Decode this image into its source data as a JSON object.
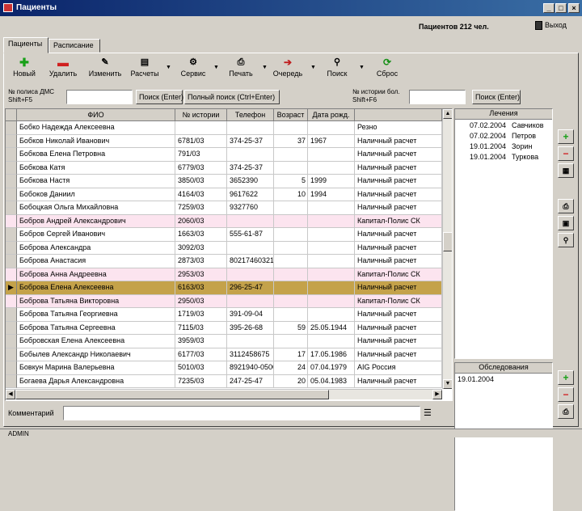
{
  "window": {
    "title": "Пациенты"
  },
  "header": {
    "count_label": "Пациентов 212 чел.",
    "exit_label": "Выход"
  },
  "tabs": [
    {
      "label": "Пациенты"
    },
    {
      "label": "Расписание"
    }
  ],
  "toolbar": {
    "new_label": "Новый",
    "delete_label": "Удалить",
    "edit_label": "Изменить",
    "bills_label": "Расчеты",
    "service_label": "Сервис",
    "print_label": "Печать",
    "queue_label": "Очередь",
    "search_label": "Поиск",
    "reset_label": "Сброс"
  },
  "search": {
    "policy_label_1": "№ полиса ДМС",
    "policy_label_2": "Shift+F5",
    "find_button": "Поиск (Enter)",
    "full_search_button": "Полный поиск (Ctrl+Enter)",
    "history_label_1": "№ истории бол.",
    "history_label_2": "Shift+F6",
    "find_button_2": "Поиск (Enter)"
  },
  "grid": {
    "columns": [
      "ФИО",
      "№ истории",
      "Телефон",
      "Возраст",
      "Дата рожд.",
      ""
    ],
    "rows": [
      {
        "name": "Бобко Надежда Алексеевна",
        "hist": "",
        "phone": "",
        "age": "",
        "dob": "",
        "pay": "Резно",
        "type": ""
      },
      {
        "name": "Бобков Николай Иванович",
        "hist": "6781/03",
        "phone": "374-25-37",
        "age": "37",
        "dob": "1967",
        "pay": "Наличный расчет",
        "type": ""
      },
      {
        "name": "Бобкова Елена Петровна",
        "hist": "791/03",
        "phone": "",
        "age": "",
        "dob": "",
        "pay": "Наличный расчет",
        "type": ""
      },
      {
        "name": "Бобкова Катя",
        "hist": "6779/03",
        "phone": "374-25-37",
        "age": "",
        "dob": "",
        "pay": "Наличный расчет",
        "type": ""
      },
      {
        "name": "Бобкова Настя",
        "hist": "3850/03",
        "phone": "3652390",
        "age": "5",
        "dob": "1999",
        "pay": "Наличный расчет",
        "type": ""
      },
      {
        "name": "Бобоков Даниил",
        "hist": "4164/03",
        "phone": "9617622",
        "age": "10",
        "dob": "1994",
        "pay": "Наличный расчет",
        "type": ""
      },
      {
        "name": "Бобоцкая Ольга Михайловна",
        "hist": "7259/03",
        "phone": "9327760",
        "age": "",
        "dob": "",
        "pay": "Наличный расчет",
        "type": ""
      },
      {
        "name": "Бобров Андрей Александрович",
        "hist": "2060/03",
        "phone": "",
        "age": "",
        "dob": "",
        "pay": "Капитал-Полис СК",
        "type": "pink"
      },
      {
        "name": "Бобров Сергей Иванович",
        "hist": "1663/03",
        "phone": "555-61-87",
        "age": "",
        "dob": "",
        "pay": "Наличный расчет",
        "type": ""
      },
      {
        "name": "Боброва Александра",
        "hist": "3092/03",
        "phone": "",
        "age": "",
        "dob": "",
        "pay": "Наличный расчет",
        "type": ""
      },
      {
        "name": "Боброва Анастасия",
        "hist": "2873/03",
        "phone": "80217460321",
        "age": "",
        "dob": "",
        "pay": "Наличный расчет",
        "type": ""
      },
      {
        "name": "Боброва Анна Андреевна",
        "hist": "2953/03",
        "phone": "",
        "age": "",
        "dob": "",
        "pay": "Капитал-Полис СК",
        "type": "pink"
      },
      {
        "name": "Боброва Елена Алексеевна",
        "hist": "6163/03",
        "phone": "296-25-47",
        "age": "",
        "dob": "",
        "pay": "Наличный расчет",
        "type": "sel"
      },
      {
        "name": "Боброва Татьяна Викторовна",
        "hist": "2950/03",
        "phone": "",
        "age": "",
        "dob": "",
        "pay": "Капитал-Полис СК",
        "type": "pink"
      },
      {
        "name": "Боброва Татьяна Георгиевна",
        "hist": "1719/03",
        "phone": "391-09-04",
        "age": "",
        "dob": "",
        "pay": "Наличный расчет",
        "type": ""
      },
      {
        "name": "Боброва Татьяна Сергеевна",
        "hist": "7115/03",
        "phone": "395-26-68",
        "age": "59",
        "dob": "25.05.1944",
        "pay": "Наличный расчет",
        "type": ""
      },
      {
        "name": "Бобровская Елена Алексеевна",
        "hist": "3959/03",
        "phone": "",
        "age": "",
        "dob": "",
        "pay": "Наличный расчет",
        "type": ""
      },
      {
        "name": "Бобылев Александр Николаевич",
        "hist": "6177/03",
        "phone": "3112458675",
        "age": "17",
        "dob": "17.05.1986",
        "pay": "Наличный расчет",
        "type": ""
      },
      {
        "name": "Бовкун Марина Валерьевна",
        "hist": "5010/03",
        "phone": "8921940-0500",
        "age": "24",
        "dob": "07.04.1979",
        "pay": "AIG Россия",
        "type": ""
      },
      {
        "name": "Богаева Дарья Александровна",
        "hist": "7235/03",
        "phone": "247-25-47",
        "age": "20",
        "dob": "05.04.1983",
        "pay": "Наличный расчет",
        "type": ""
      }
    ]
  },
  "visits": {
    "header": "Лечения",
    "items": [
      {
        "date": "07.02.2004",
        "doctor": "Савчиков"
      },
      {
        "date": "07.02.2004",
        "doctor": "Петров"
      },
      {
        "date": "19.01.2004",
        "doctor": "Зорин"
      },
      {
        "date": "19.01.2004",
        "doctor": "Туркова"
      }
    ]
  },
  "exams": {
    "header": "Обследования",
    "items": [
      {
        "date": "19.01.2004"
      }
    ]
  },
  "comment": {
    "label": "Комментарий",
    "value": ""
  },
  "status": {
    "user": "ADMIN"
  }
}
